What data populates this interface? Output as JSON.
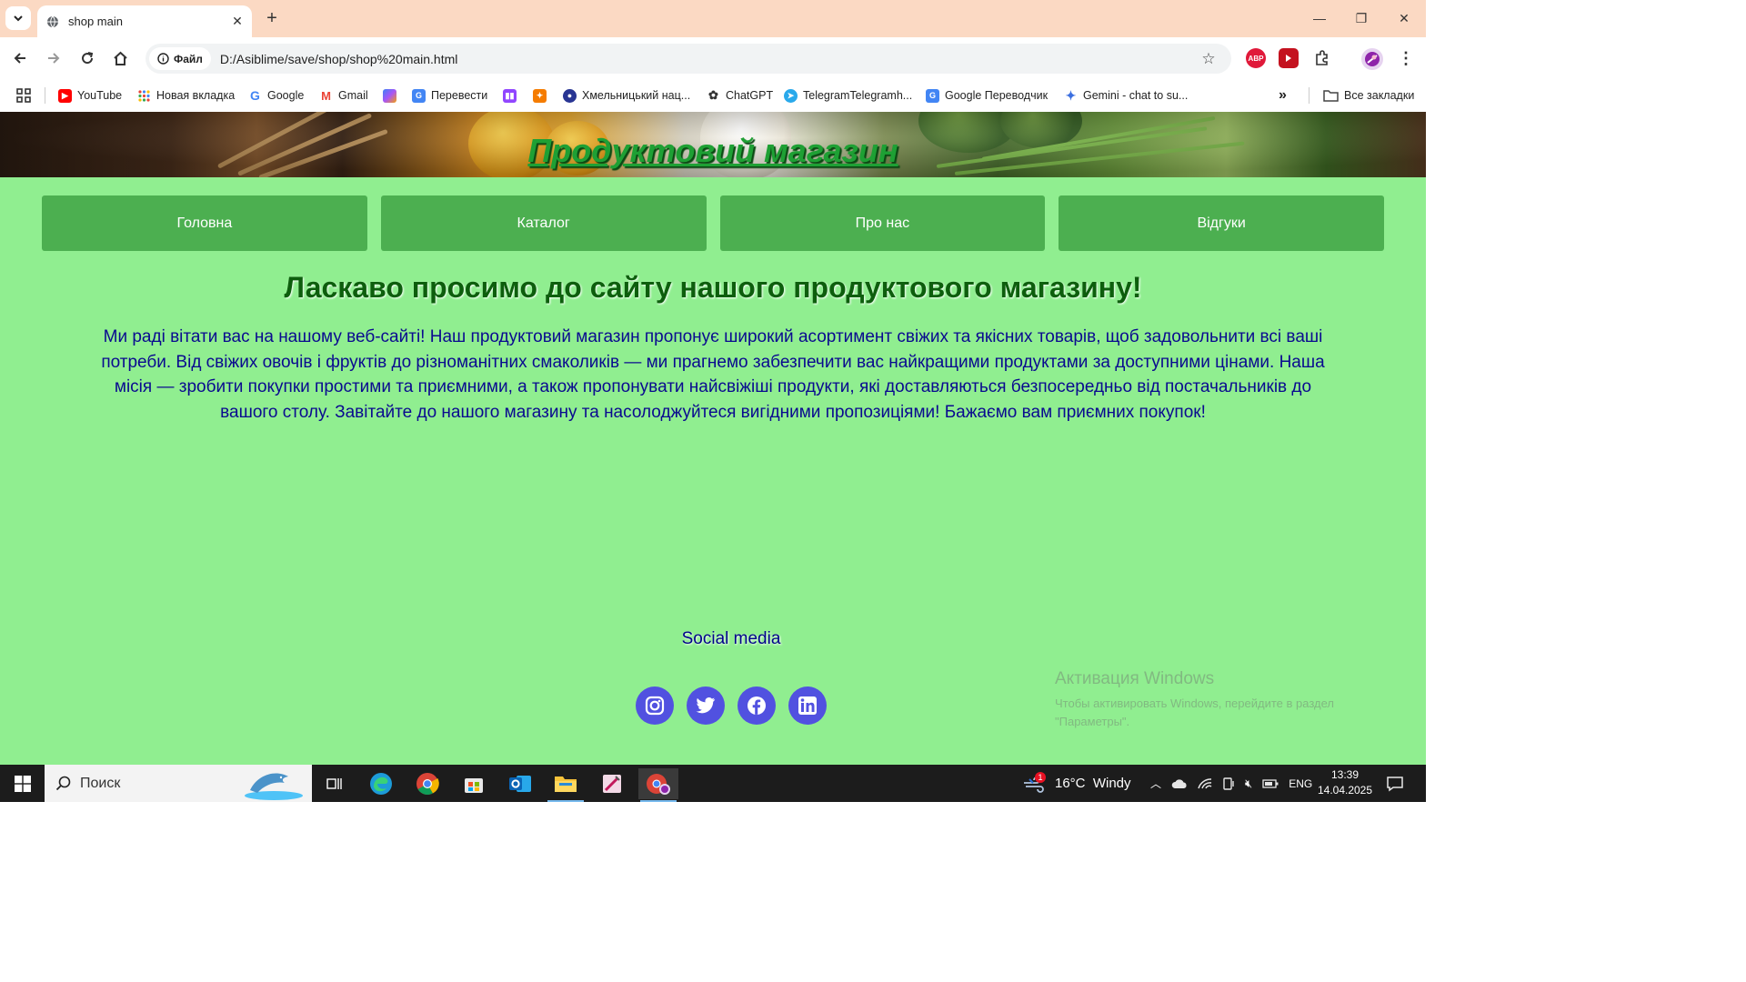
{
  "browser": {
    "tab_title": "shop main",
    "file_chip": "Файл",
    "url": "D:/Asiblime/save/shop/shop%20main.html",
    "extensions": {
      "abp": "ABP"
    },
    "bookmarks": [
      {
        "label": "YouTube",
        "icon": "youtube-icon"
      },
      {
        "label": "Новая вкладка",
        "icon": "apps-grid-icon"
      },
      {
        "label": "Google",
        "icon": "google-icon"
      },
      {
        "label": "Gmail",
        "icon": "gmail-icon"
      },
      {
        "label": "",
        "icon": "copilot-icon"
      },
      {
        "label": "Перевести",
        "icon": "translate-icon"
      },
      {
        "label": "",
        "icon": "twitch-icon"
      },
      {
        "label": "",
        "icon": "gamepad-icon"
      },
      {
        "label": "Хмельницький нац...",
        "icon": "university-icon"
      },
      {
        "label": "ChatGPT",
        "icon": "chatgpt-icon"
      },
      {
        "label": "TelegramTelegramh...",
        "icon": "telegram-icon"
      },
      {
        "label": "Google Переводчик",
        "icon": "google-translate-icon"
      },
      {
        "label": "Gemini - chat to su...",
        "icon": "gemini-icon"
      }
    ],
    "all_bookmarks": "Все закладки"
  },
  "page": {
    "title": "Продуктовий магазин",
    "menu": [
      "Головна",
      "Каталог",
      "Про нас",
      "Відгуки"
    ],
    "welcome": "Ласкаво просимо до сайту нашого продуктового магазину!",
    "intro": "Ми раді вітати вас на нашому веб-сайті! Наш продуктовий магазин пропонує широкий асортимент свіжих та якісних товарів, щоб задовольнити всі ваші потреби. Від свіжих овочів і фруктів до різноманітних смаколиків — ми прагнемо забезпечити вас найкращими продуктами за доступними цінами. Наша місія — зробити покупки простими та приємними, а також пропонувати найсвіжіші продукти, які доставляються безпосередньо від постачальників до вашого столу. Завітайте до нашого магазину та насолоджуйтеся вигідними пропозиціями! Бажаємо вам приємних покупок!",
    "social_title": "Social media",
    "social": [
      "instagram-icon",
      "twitter-icon",
      "facebook-icon",
      "linkedin-icon"
    ],
    "social_color": "#5151e0",
    "background": "#90ee90",
    "menu_color": "#4caf50"
  },
  "watermark": {
    "title": "Активация Windows",
    "subtitle_line1": "Чтобы активировать Windows, перейдите в раздел",
    "subtitle_line2": "\"Параметры\"."
  },
  "taskbar": {
    "search_placeholder": "Поиск",
    "weather_badge": "1",
    "weather": "16°C  Windy",
    "lang": "ENG",
    "time": "13:39",
    "date": "14.04.2025"
  }
}
